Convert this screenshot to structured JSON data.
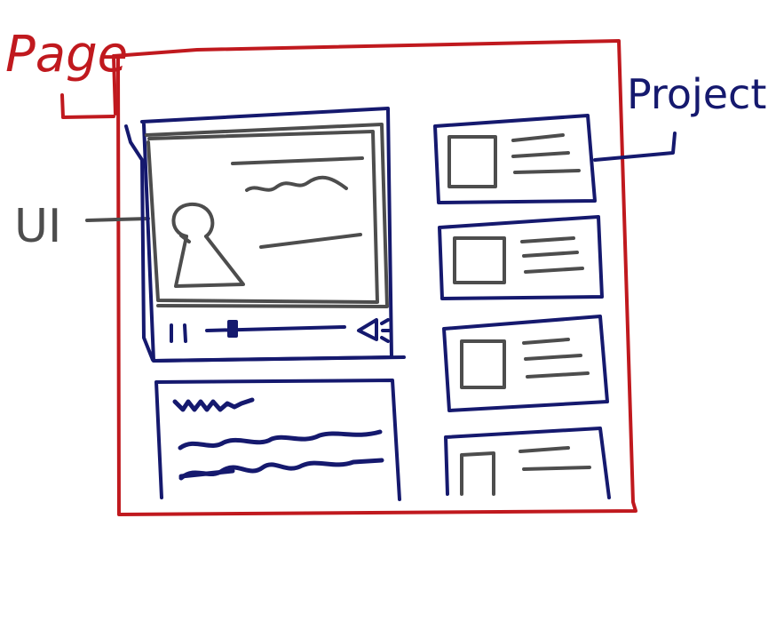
{
  "labels": {
    "page": "Page",
    "ui": "UI",
    "project": "Project"
  },
  "colors": {
    "page_red": "#c0191e",
    "frame_navy": "#15196e",
    "ui_gray": "#4d4d4d",
    "background": "#ffffff"
  },
  "media_controls": {
    "play_state": "paused",
    "seek_progress": 0.17
  },
  "project_cards_count": 4,
  "icons": [
    "person-icon",
    "pause-icon",
    "volume-icon",
    "thumbnail-icon"
  ]
}
